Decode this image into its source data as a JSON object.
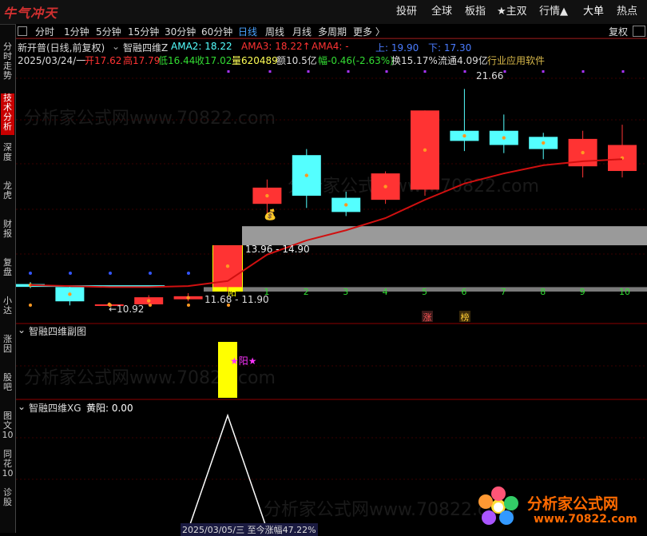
{
  "topbar": {
    "logo": "牛气冲天",
    "nav": [
      "投研",
      "全球",
      "板指",
      "★主双",
      "行情▲",
      "大单",
      "热点"
    ]
  },
  "tabs": [
    "分时",
    "1分钟",
    "5分钟",
    "15分钟",
    "30分钟",
    "60分钟",
    "日线",
    "周线",
    "月线",
    "多周期",
    "更多 〉"
  ],
  "active_tab": "日线",
  "fuquan": "复权",
  "sidebar": [
    "分时走势",
    "技术分析",
    "深度",
    "龙虎",
    "财报",
    "复盘",
    "小达",
    "涨因",
    "股吧",
    "图文10",
    "同花10",
    "诊股"
  ],
  "main_panel": {
    "stock": "新开普(日线,前复权)",
    "indicator": "智融四维Z",
    "ama2": "AMA2: 18.22",
    "ama3": "AMA3: 18.22↑",
    "ama4": "AMA4: -",
    "up": "上: 19.90",
    "down": "下: 17.30",
    "date": "2025/03/24/一",
    "open": "开17.62",
    "high": "高17.79",
    "low": "低16.44",
    "close": "收17.02",
    "volume": "量620489",
    "amount": "额10.5亿",
    "change": "幅-0.46(-2.63%)",
    "turnover": "换15.17%",
    "float": "流通4.09亿",
    "industry": "行业应用软件",
    "annot_high": "21.66",
    "annot_zone": "13.96 - 14.90",
    "annot_low": "←10.92",
    "annot_range": "11.68 - 11.90",
    "annot_yang": "阳",
    "day_counts": [
      "1",
      "2",
      "3",
      "4",
      "5",
      "6",
      "7",
      "8",
      "9",
      "10"
    ],
    "markers": [
      "涨",
      "榜"
    ]
  },
  "sub_panel": {
    "title": "智融四维副图",
    "label": "★阳★"
  },
  "xg_panel": {
    "title": "智融四维XG",
    "value": "黄阳: 0.00",
    "footer": "2025/03/05/三 至今涨幅47.22%"
  },
  "watermark": "分析家公式网www.70822.com",
  "brand": {
    "name": "分析家公式网",
    "url": "www.70822.com"
  },
  "colors": {
    "up": "#ff3333",
    "down": "#54ffff",
    "ma": "#d01010",
    "signal": "#ffff00"
  },
  "chart_data": {
    "type": "candlestick",
    "price_range": [
      10.5,
      22.5
    ],
    "candles": [
      {
        "open": 12.05,
        "close": 11.95,
        "high": 12.15,
        "low": 11.85
      },
      {
        "open": 11.9,
        "close": 11.2,
        "high": 11.95,
        "low": 11.0
      },
      {
        "open": 11.05,
        "close": 11.05,
        "high": 11.15,
        "low": 10.92
      },
      {
        "open": 11.05,
        "close": 11.4,
        "high": 11.5,
        "low": 11.0
      },
      {
        "open": 11.3,
        "close": 11.45,
        "high": 11.6,
        "low": 11.2
      },
      {
        "open": 11.9,
        "close": 13.96,
        "high": 13.96,
        "low": 11.68
      },
      {
        "open": 16.0,
        "close": 16.8,
        "high": 17.2,
        "low": 15.4
      },
      {
        "open": 18.4,
        "close": 16.4,
        "high": 18.7,
        "low": 15.8
      },
      {
        "open": 16.3,
        "close": 15.6,
        "high": 16.6,
        "low": 15.4
      },
      {
        "open": 16.2,
        "close": 17.5,
        "high": 17.6,
        "low": 16.0
      },
      {
        "open": 16.7,
        "close": 20.6,
        "high": 20.6,
        "low": 16.4
      },
      {
        "open": 19.6,
        "close": 19.1,
        "high": 21.66,
        "low": 18.6
      },
      {
        "open": 19.6,
        "close": 18.9,
        "high": 20.4,
        "low": 18.5
      },
      {
        "open": 19.3,
        "close": 18.7,
        "high": 19.5,
        "low": 18.2
      },
      {
        "open": 17.85,
        "close": 19.2,
        "high": 19.6,
        "low": 17.3
      },
      {
        "open": 17.62,
        "close": 18.9,
        "high": 19.9,
        "low": 17.3
      }
    ],
    "ma_line": [
      12.0,
      11.95,
      11.9,
      11.9,
      11.95,
      12.2,
      13.5,
      14.2,
      14.7,
      15.3,
      16.2,
      17.0,
      17.5,
      17.9,
      18.1,
      18.2
    ],
    "xg_peak": 1
  }
}
